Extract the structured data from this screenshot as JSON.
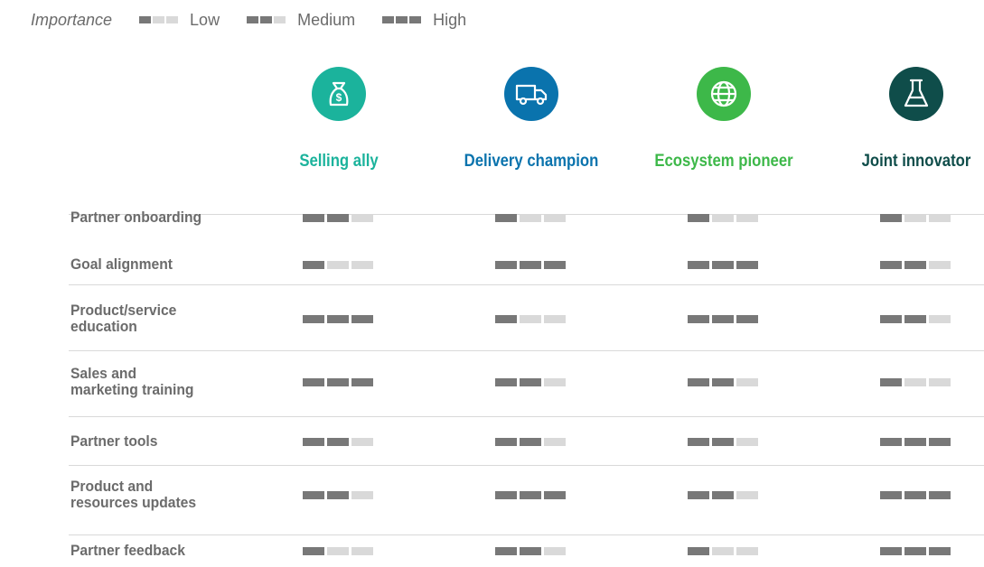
{
  "legend": {
    "title": "Importance",
    "levels": [
      {
        "label": "Low",
        "value": 1
      },
      {
        "label": "Medium",
        "value": 2
      },
      {
        "label": "High",
        "value": 3
      }
    ]
  },
  "colors": {
    "bar_on": "#787878",
    "bar_off": "#d9d9d9",
    "label_gray": "#6b6b6b"
  },
  "chart_data": {
    "type": "table",
    "scale_max": 3,
    "columns": [
      {
        "label": "Selling ally",
        "color": "#1bb39c",
        "icon": "money-bag-icon"
      },
      {
        "label": "Delivery champion",
        "color": "#0a73ad",
        "icon": "truck-icon"
      },
      {
        "label": "Ecosystem pioneer",
        "color": "#3db849",
        "icon": "globe-icon"
      },
      {
        "label": "Joint innovator",
        "color": "#0f4d4a",
        "icon": "flask-icon"
      }
    ],
    "rows": [
      {
        "label": [
          "Partner onboarding"
        ],
        "values": [
          2,
          1,
          1,
          1
        ]
      },
      {
        "label": [
          "Goal alignment"
        ],
        "values": [
          1,
          3,
          3,
          2
        ]
      },
      {
        "label": [
          "Product/service",
          "education"
        ],
        "values": [
          3,
          1,
          3,
          2
        ]
      },
      {
        "label": [
          "Sales and",
          "marketing training"
        ],
        "values": [
          3,
          2,
          2,
          1
        ]
      },
      {
        "label": [
          "Partner tools"
        ],
        "values": [
          2,
          2,
          2,
          3
        ]
      },
      {
        "label": [
          "Product and",
          "resources updates"
        ],
        "values": [
          2,
          3,
          2,
          3
        ]
      },
      {
        "label": [
          "Partner feedback"
        ],
        "values": [
          1,
          2,
          1,
          3
        ]
      }
    ]
  }
}
